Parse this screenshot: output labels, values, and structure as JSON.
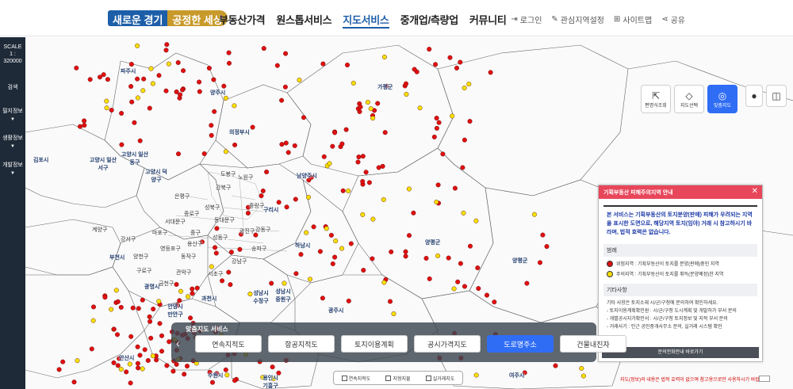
{
  "header": {
    "logo_part1": "새로운 경기",
    "logo_part2": "공정한 세상",
    "nav": [
      "부동산가격",
      "원스톱서비스",
      "지도서비스",
      "중개업/측량업",
      "커뮤니티"
    ],
    "active_nav": "지도서비스",
    "util": [
      "로그인",
      "관심지역설정",
      "사이트맵",
      "공유"
    ]
  },
  "sidebar": {
    "scale_label": "SCALE",
    "scale_value": "1 : 320000",
    "items": [
      "검색",
      "필지정보",
      "생활정보",
      "개발정보"
    ]
  },
  "map_tools": {
    "buttons": [
      "편명식조회",
      "지도선택",
      "맞춤지도"
    ],
    "active": "맞춤지도",
    "zoom_in": "+",
    "zoom_out": "−"
  },
  "cities": [
    {
      "name": "파주시"
    },
    {
      "name": "양주시"
    },
    {
      "name": "가평군"
    },
    {
      "name": "의정부시"
    },
    {
      "name": "고양시 일산서구"
    },
    {
      "name": "고양시 일산동구"
    },
    {
      "name": "고양시 덕양구"
    },
    {
      "name": "김포시"
    },
    {
      "name": "남양주시"
    },
    {
      "name": "구리시"
    },
    {
      "name": "하남시"
    },
    {
      "name": "양평군"
    },
    {
      "name": "광명시"
    },
    {
      "name": "부천시"
    },
    {
      "name": "안양시 만안구"
    },
    {
      "name": "과천시"
    },
    {
      "name": "성남시 수정구"
    },
    {
      "name": "성남시 중원구"
    },
    {
      "name": "광주시"
    },
    {
      "name": "안산시"
    },
    {
      "name": "수원시"
    },
    {
      "name": "용인시 기흥구"
    },
    {
      "name": "여주시"
    },
    {
      "name": "도봉구"
    },
    {
      "name": "노원구"
    },
    {
      "name": "강북구"
    },
    {
      "name": "은평구"
    },
    {
      "name": "성북구"
    },
    {
      "name": "종로구"
    },
    {
      "name": "중랑구"
    },
    {
      "name": "동대문구"
    },
    {
      "name": "서대문구"
    },
    {
      "name": "마포구"
    },
    {
      "name": "중구"
    },
    {
      "name": "성동구"
    },
    {
      "name": "광진구"
    },
    {
      "name": "강서구"
    },
    {
      "name": "양천구"
    },
    {
      "name": "영등포구"
    },
    {
      "name": "동작구"
    },
    {
      "name": "관악구"
    },
    {
      "name": "서초구"
    },
    {
      "name": "강남구"
    },
    {
      "name": "송파구"
    },
    {
      "name": "강동구"
    },
    {
      "name": "구로구"
    },
    {
      "name": "금천구"
    },
    {
      "name": "용산구"
    },
    {
      "name": "계양구"
    }
  ],
  "popup": {
    "title": "기획부동산 피해주의지역 안내",
    "intro": "본 서비스는 기획부동산의 토지분양(판매) 피해가 우려되는 지역을 표시한 도면으로, 해당지역 토지(임야) 거래 시 참고하시기 바라며, 법적 효력은 없습니다.",
    "legend_title": "범례",
    "legend": [
      {
        "label": "위험지역 : 기획부동산이 토지를 분양(판매)중인 지역",
        "color": "#e01010"
      },
      {
        "label": "주의지역 : 기획부동산이 토지를 취득(분양예정)한 지역",
        "color": "#f5e000"
      }
    ],
    "etc_title": "기타사항",
    "etc_lines": [
      "기타 사항은 토지소재 시/군/구청에 문의하여 확인하세요.",
      "- 토지이용계획확인원 : 시/군/구청 도시계획 및 개발허가 부서 문의",
      "- 개별공시지가확인서 : 시/군/구청 토지정보 및 지적 부서 문의",
      "- 거래사기 : 인근 공인중개사무소 문의, 실거래 시스템 확인"
    ],
    "footer_button": "문의전화안내 바로가기"
  },
  "service": {
    "title": "맞춤지도 서비스",
    "buttons": [
      "연속지적도",
      "항공지적도",
      "토지이용계획",
      "공시가격지도",
      "도로명주소",
      "건물내진자"
    ],
    "active": "도로명주소"
  },
  "layers": [
    "연속지적도",
    "지형지물",
    "실거래지도"
  ],
  "footnote": "지도(정보)의 내용은 법적 효력이 없으며 참고용으로만 사용하시기 바랍니다.",
  "colors": {
    "danger": "#e01010",
    "caution": "#f5e000",
    "accent": "#2f6df5",
    "popup_header": "#e8465a"
  }
}
